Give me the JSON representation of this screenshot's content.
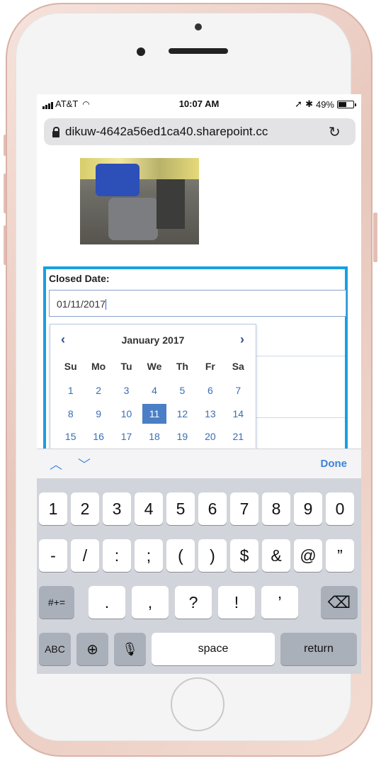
{
  "status_bar": {
    "carrier": "AT&T",
    "time": "10:07 AM",
    "battery": "49%",
    "battery_level": 0.49
  },
  "browser": {
    "url": "dikuw-4642a56ed1ca40.sharepoint.cc"
  },
  "form": {
    "closed_date_label": "Closed Date:",
    "closed_date_value": "01/11/2017"
  },
  "datepicker": {
    "prev": "‹",
    "next": "›",
    "title": "January 2017",
    "weekdays": [
      "Su",
      "Mo",
      "Tu",
      "We",
      "Th",
      "Fr",
      "Sa"
    ],
    "weeks": [
      [
        "1",
        "2",
        "3",
        "4",
        "5",
        "6",
        "7"
      ],
      [
        "8",
        "9",
        "10",
        "11",
        "12",
        "13",
        "14"
      ],
      [
        "15",
        "16",
        "17",
        "18",
        "19",
        "20",
        "21"
      ]
    ],
    "selected_day": "11"
  },
  "accessory": {
    "done": "Done"
  },
  "keyboard": {
    "row1": [
      "1",
      "2",
      "3",
      "4",
      "5",
      "6",
      "7",
      "8",
      "9",
      "0"
    ],
    "row2": [
      "-",
      "/",
      ":",
      ";",
      "(",
      ")",
      "$",
      "&",
      "@",
      "”"
    ],
    "row3": [
      "#+=",
      ".",
      ",",
      "?",
      "!",
      "’"
    ],
    "bottom": {
      "abc": "ABC",
      "space": "space",
      "return": "return"
    }
  },
  "colors": {
    "highlight": "#16a0e0",
    "selected_day": "#4a7fc6",
    "link_blue": "#3b83d9"
  }
}
